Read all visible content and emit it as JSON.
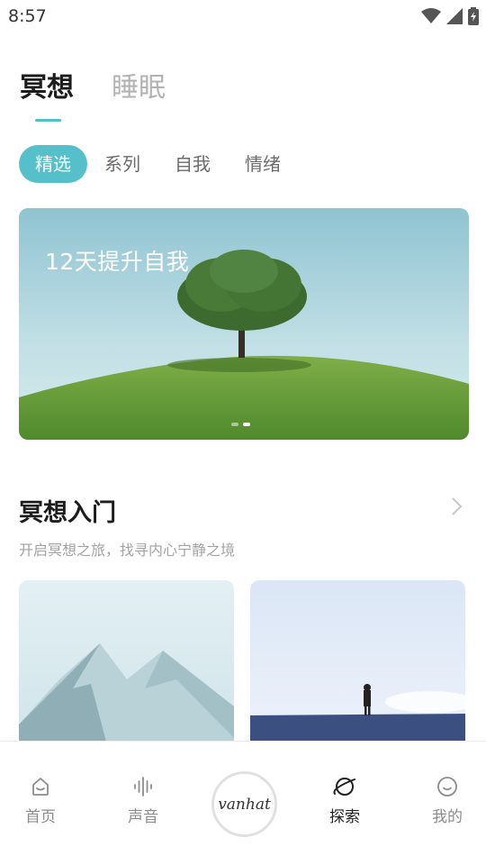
{
  "status_bar": {
    "time": "8:57",
    "icons": [
      "wifi-icon",
      "signal-icon",
      "battery-charging-icon"
    ]
  },
  "top_tabs": [
    {
      "label": "冥想",
      "active": true
    },
    {
      "label": "睡眠",
      "active": false
    }
  ],
  "sub_tabs": [
    {
      "label": "精选",
      "active": true
    },
    {
      "label": "系列",
      "active": false
    },
    {
      "label": "自我",
      "active": false
    },
    {
      "label": "情绪",
      "active": false
    }
  ],
  "banner": {
    "title": "12天提升自我",
    "page_count": 2,
    "active_page": 2
  },
  "section": {
    "title": "冥想入门",
    "subtitle": "开启冥想之旅，找寻内心宁静之境",
    "cards": [
      {
        "image": "snowy-mountain"
      },
      {
        "image": "hiker-on-hill"
      }
    ]
  },
  "bottom_nav": {
    "items": [
      {
        "label": "首页",
        "icon": "home-icon",
        "active": false
      },
      {
        "label": "声音",
        "icon": "sound-wave-icon",
        "active": false
      },
      {
        "label": "探索",
        "icon": "planet-icon",
        "active": true
      },
      {
        "label": "我的",
        "icon": "smiley-icon",
        "active": false
      }
    ],
    "center_logo": "vanhat"
  },
  "colors": {
    "accent": "#55c0c9",
    "text_primary": "#1d1d1d",
    "text_secondary": "#a3a3a3"
  }
}
